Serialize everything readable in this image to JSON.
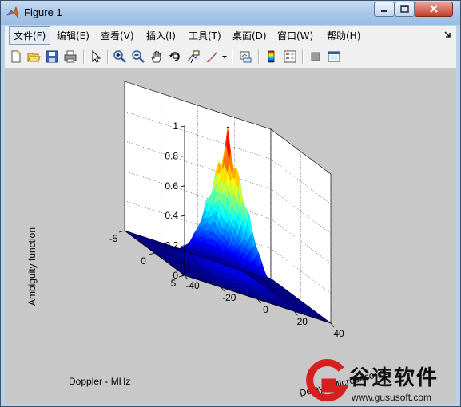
{
  "window": {
    "title": "Figure 1",
    "buttons": {
      "minimize": "minimize-icon",
      "maximize": "maximize-icon",
      "close": "close-icon"
    }
  },
  "menu": {
    "items": [
      "文件(F)",
      "编辑(E)",
      "查看(V)",
      "插入(I)",
      "工具(T)",
      "桌面(D)",
      "窗口(W)",
      "帮助(H)"
    ],
    "active_index": 0,
    "dock_arrow": "dock-arrow-icon"
  },
  "toolbar": {
    "tools": [
      "new-figure-icon",
      "open-icon",
      "save-icon",
      "print-icon",
      "select-arrow-icon",
      "zoom-in-icon",
      "zoom-out-icon",
      "pan-hand-icon",
      "rotate-3d-icon",
      "data-cursor-icon",
      "brush-icon",
      "brush-dropdown-icon",
      "link-plot-icon",
      "colorbar-icon",
      "legend-icon",
      "hide-plot-tools-icon",
      "show-plot-tools-icon"
    ]
  },
  "chart_data": {
    "type": "surface",
    "xlabel": "Doppler - MHz",
    "ylabel": "Delay - Microseconds",
    "zlabel": "Ambiguity function",
    "xlim": [
      -5,
      5
    ],
    "ylim": [
      -40,
      40
    ],
    "zlim": [
      0,
      1
    ],
    "x_ticks": [
      "5",
      "0",
      "-5"
    ],
    "y_ticks": [
      "-40",
      "-20",
      "0",
      "20",
      "40"
    ],
    "z_ticks": [
      "0",
      "0.2",
      "0.4",
      "0.6",
      "0.8",
      "1"
    ],
    "peak": {
      "doppler": 0,
      "delay": 0,
      "value": 1.0
    },
    "colormap": "jet",
    "grid": true,
    "view": "3-D"
  },
  "watermark": {
    "main_text": "谷速软件",
    "url": "www.gususoft.com"
  }
}
